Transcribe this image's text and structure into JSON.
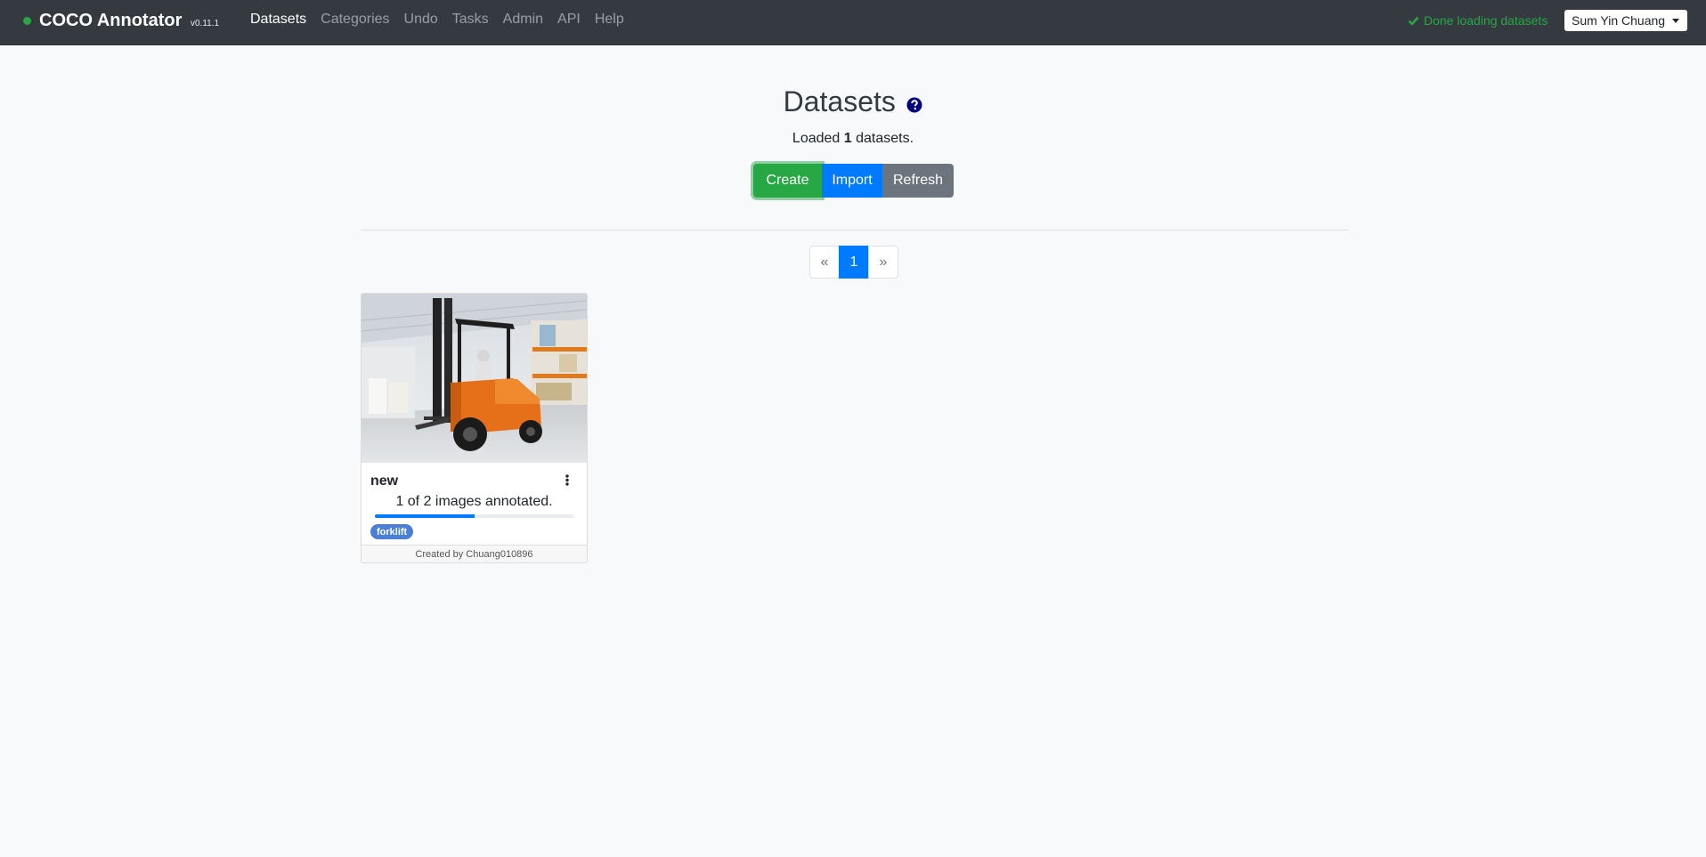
{
  "navbar": {
    "brand": "COCO Annotator",
    "version": "v0.11.1",
    "links": [
      {
        "label": "Datasets",
        "active": true
      },
      {
        "label": "Categories",
        "active": false
      },
      {
        "label": "Undo",
        "active": false
      },
      {
        "label": "Tasks",
        "active": false
      },
      {
        "label": "Admin",
        "active": false
      },
      {
        "label": "API",
        "active": false
      },
      {
        "label": "Help",
        "active": false
      }
    ],
    "status": "Done loading datasets",
    "user": "Sum Yin Chuang"
  },
  "header": {
    "title": "Datasets",
    "loaded_prefix": "Loaded",
    "loaded_count": "1",
    "loaded_suffix": "datasets.",
    "buttons": {
      "create": "Create",
      "import": "Import",
      "refresh": "Refresh"
    }
  },
  "pagination": {
    "prev": "«",
    "current": "1",
    "next": "»"
  },
  "datasets": [
    {
      "name": "new",
      "annotated_text": "1 of 2 images annotated.",
      "progress": 0.5,
      "categories": [
        "forklift"
      ],
      "footer": "Created by Chuang010896"
    }
  ],
  "colors": {
    "navbar": "#343a40",
    "success": "#28a745",
    "primary": "#007bff",
    "secondary": "#6c757d",
    "badge": "#4a7fd8"
  },
  "icons": {
    "status": "check-icon",
    "help": "question-circle-icon",
    "menu": "kebab-icon",
    "user_menu": "caret-down-icon"
  }
}
